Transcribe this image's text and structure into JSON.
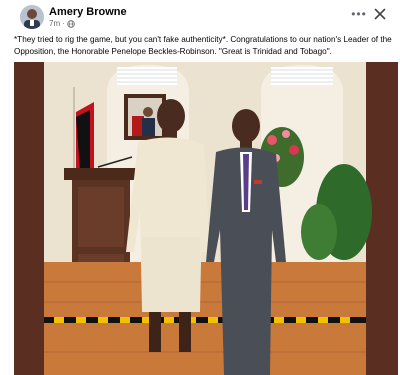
{
  "post": {
    "author": "Amery Browne",
    "time": "7m",
    "text": "*They tried to rig the game, but you can't fake authenticity*. Congratulations to our nation's Leader of the Opposition, the Honorable Penelope Beckles-Robinson. \"Great is Trinidad and Tobago\".",
    "visibility_icon": "globe-icon",
    "more_icon": "more-options-icon",
    "close_icon": "close-icon"
  },
  "colors": {
    "text_primary": "#050505",
    "text_secondary": "#65676b",
    "photo_background_wall": "#e9e0c9",
    "photo_frame_brown": "#5a2f22"
  }
}
